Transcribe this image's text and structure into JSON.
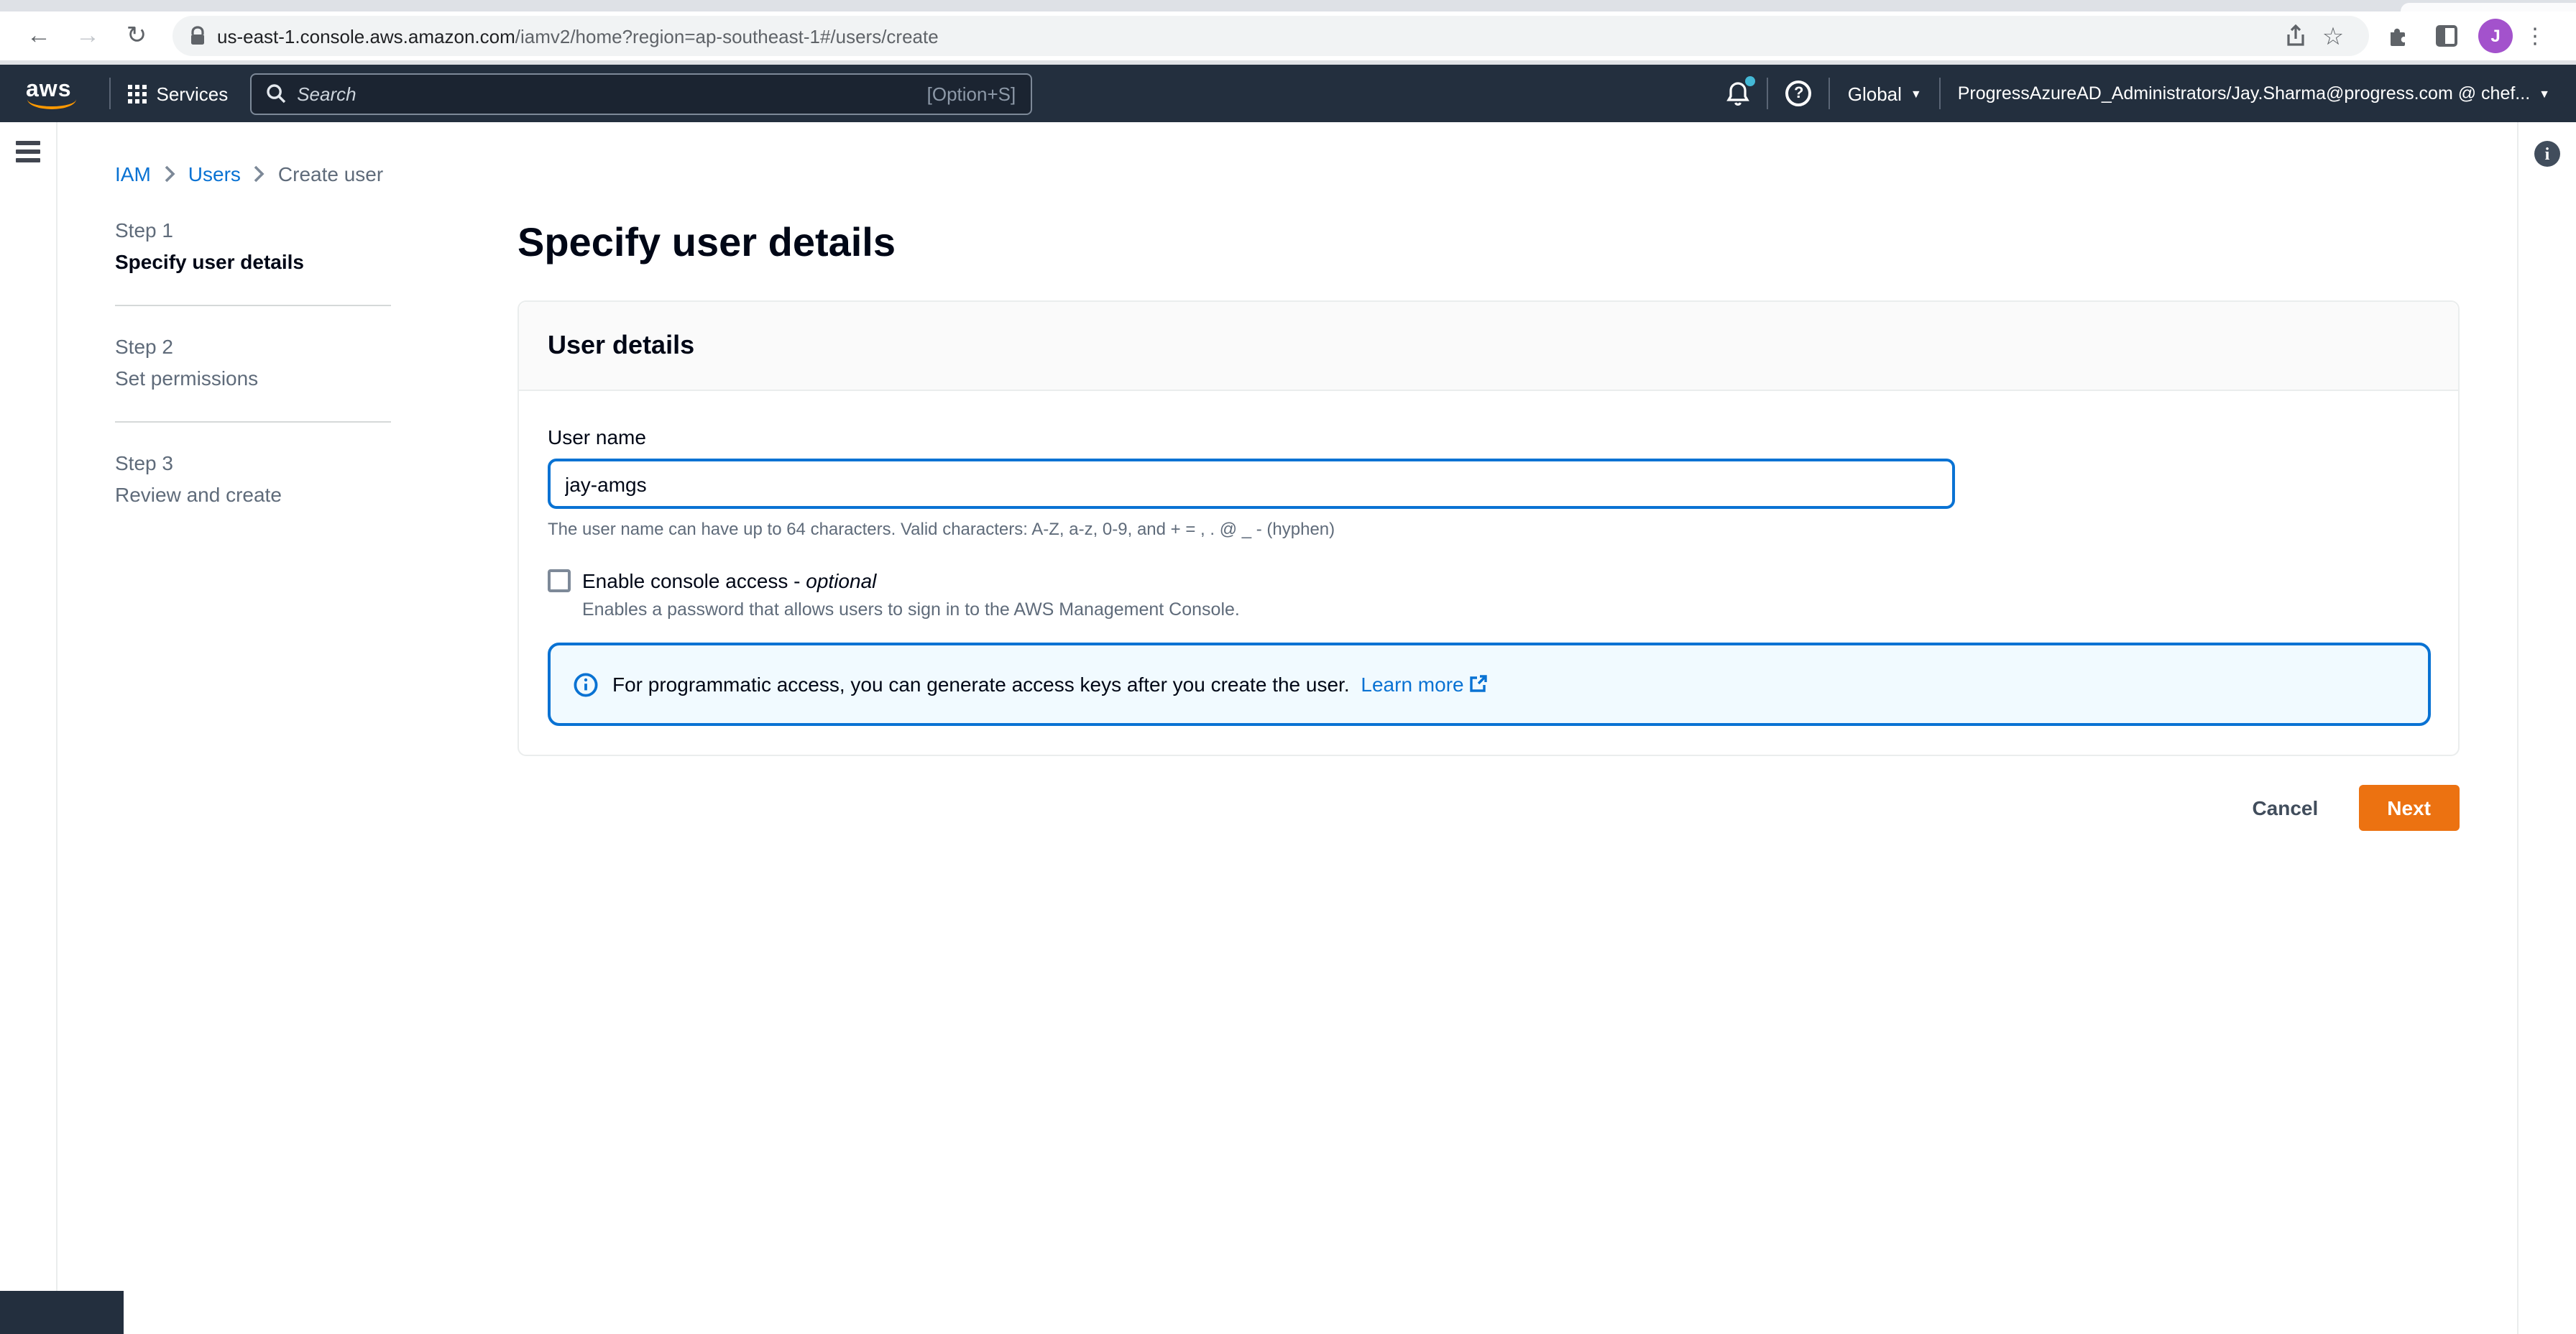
{
  "browser": {
    "url_domain": "us-east-1.console.aws.amazon.com",
    "url_path": "/iamv2/home?region=ap-southeast-1#/users/create",
    "avatar_letter": "J",
    "icons": {
      "back": "←",
      "forward": "→",
      "reload": "↻",
      "star": "☆",
      "menu": "⋮"
    }
  },
  "aws_nav": {
    "logo": "aws",
    "services_label": "Services",
    "search_placeholder": "Search",
    "search_shortcut": "[Option+S]",
    "help_glyph": "?",
    "region_label": "Global",
    "account_label": "ProgressAzureAD_Administrators/Jay.Sharma@progress.com @ chef...",
    "caret": "▼"
  },
  "side_rails": {
    "help_panel_glyph": "i"
  },
  "breadcrumb": {
    "items": [
      {
        "label": "IAM"
      },
      {
        "label": "Users"
      },
      {
        "label": "Create user"
      }
    ]
  },
  "steps": [
    {
      "step": "Step 1",
      "title": "Specify user details"
    },
    {
      "step": "Step 2",
      "title": "Set permissions"
    },
    {
      "step": "Step 3",
      "title": "Review and create"
    }
  ],
  "page": {
    "title": "Specify user details"
  },
  "user_details": {
    "header": "User details",
    "username_label": "User name",
    "username_value": "jay-amgs",
    "username_constraint": "The user name can have up to 64 characters. Valid characters: A-Z, a-z, 0-9, and + = , . @ _ - (hyphen)",
    "console_access_label": "Enable console access - ",
    "console_access_optional": "optional",
    "console_access_help": "Enables a password that allows users to sign in to the AWS Management Console.",
    "alert_text": "For programmatic access, you can generate access keys after you create the user.",
    "alert_link_label": "Learn more"
  },
  "actions": {
    "cancel_label": "Cancel",
    "next_label": "Next"
  },
  "colors": {
    "navbar": "#232f3e",
    "accent": "#0972d3",
    "primary_button": "#ec7211",
    "alert_bg": "#f1faff",
    "aws_orange": "#ff9900"
  }
}
